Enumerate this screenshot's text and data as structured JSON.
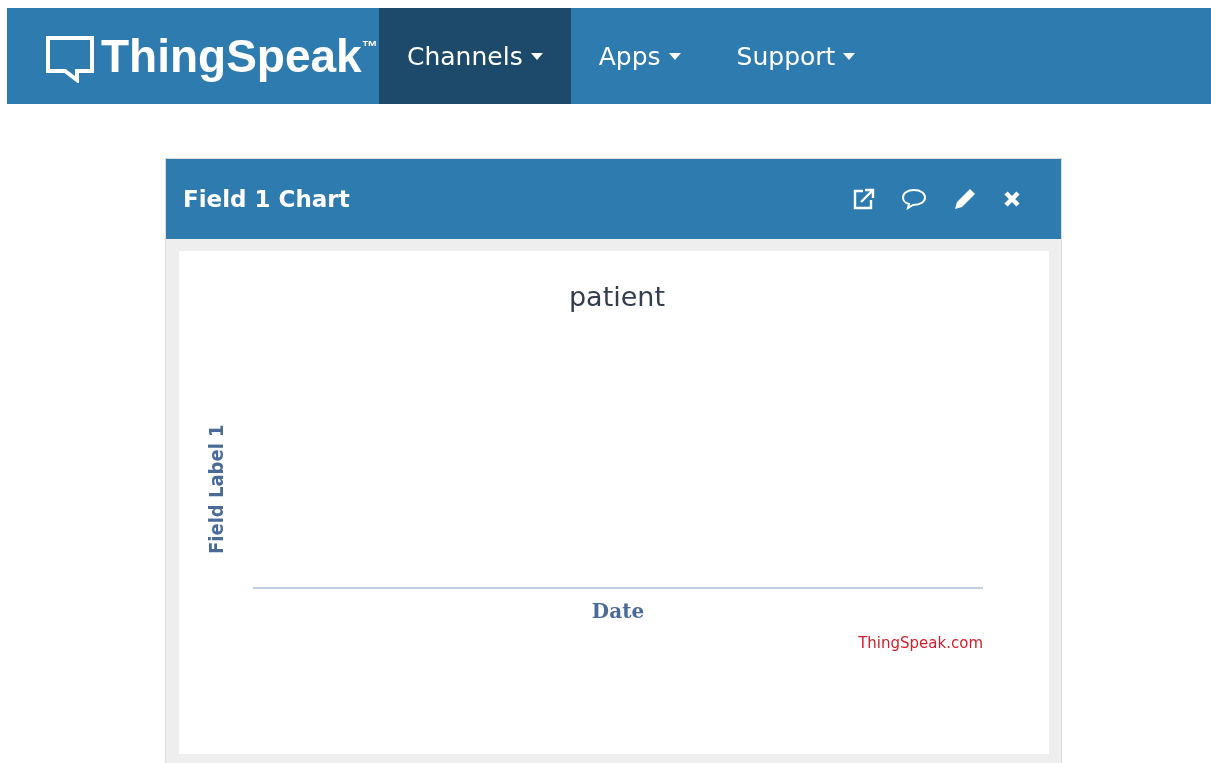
{
  "navbar": {
    "brand": "ThingSpeak",
    "trademark": "™",
    "menu": [
      {
        "label": "Channels",
        "selected": true
      },
      {
        "label": "Apps",
        "selected": false
      },
      {
        "label": "Support",
        "selected": false
      }
    ]
  },
  "panel": {
    "title": "Field 1 Chart",
    "chart": {
      "title": "patient",
      "ylabel": "Field Label 1",
      "xlabel": "Date",
      "credit": "ThingSpeak.com"
    }
  }
}
